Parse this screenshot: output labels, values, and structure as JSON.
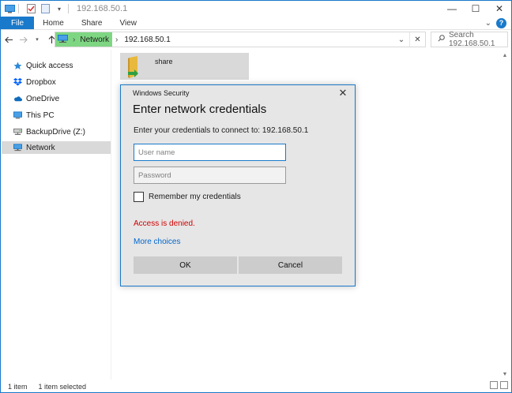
{
  "window": {
    "title": "192.168.50.1",
    "controls": {
      "minimize": "—",
      "maximize": "☐",
      "close": "✕"
    }
  },
  "ribbon": {
    "tabs": [
      {
        "label": "File"
      },
      {
        "label": "Home"
      },
      {
        "label": "Share"
      },
      {
        "label": "View"
      }
    ],
    "expand": "⌄",
    "help": "?"
  },
  "address": {
    "segments": [
      {
        "label": "Network"
      },
      {
        "label": "192.168.50.1"
      }
    ],
    "chevron": "›"
  },
  "search": {
    "placeholder": "Search 192.168.50.1"
  },
  "sidebar": {
    "items": [
      {
        "label": "Quick access"
      },
      {
        "label": "Dropbox"
      },
      {
        "label": "OneDrive"
      },
      {
        "label": "This PC"
      },
      {
        "label": "BackupDrive (Z:)"
      },
      {
        "label": "Network",
        "selected": true
      }
    ]
  },
  "content": {
    "items": [
      {
        "label": "share"
      }
    ]
  },
  "status": {
    "item_count": "1 item",
    "selected": "1 item selected"
  },
  "dialog": {
    "header": "Windows Security",
    "title": "Enter network credentials",
    "prompt": "Enter your credentials to connect to: 192.168.50.1",
    "username_placeholder": "User name",
    "password_placeholder": "Password",
    "remember_label": "Remember my credentials",
    "error": "Access is denied.",
    "more_choices": "More choices",
    "ok_label": "OK",
    "cancel_label": "Cancel"
  },
  "colors": {
    "accent": "#1979ca",
    "address_highlight": "#7ed683",
    "error": "#d00000",
    "link": "#0066cc",
    "selected_bg": "#d9d9d9"
  }
}
